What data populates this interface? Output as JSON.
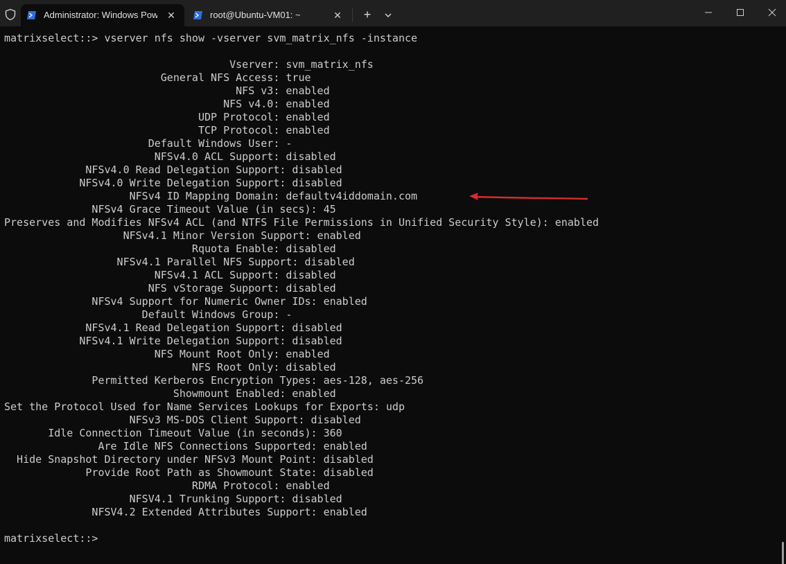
{
  "tabs": [
    {
      "label": "Administrator: Windows Powe",
      "active": true,
      "icon": "powershell-icon"
    },
    {
      "label": "root@Ubuntu-VM01: ~",
      "active": false,
      "icon": "powershell-icon"
    }
  ],
  "titlebar": {
    "new_tab": "+",
    "close_glyph": "✕"
  },
  "terminal": {
    "command_line": "matrixselect::> vserver nfs show -vserver svm_matrix_nfs -instance",
    "output_lines": [
      "                                    Vserver: svm_matrix_nfs",
      "                         General NFS Access: true",
      "                                     NFS v3: enabled",
      "                                   NFS v4.0: enabled",
      "                               UDP Protocol: enabled",
      "                               TCP Protocol: enabled",
      "                       Default Windows User: -",
      "                        NFSv4.0 ACL Support: disabled",
      "             NFSv4.0 Read Delegation Support: disabled",
      "            NFSv4.0 Write Delegation Support: disabled",
      "                    NFSv4 ID Mapping Domain: defaultv4iddomain.com",
      "              NFSv4 Grace Timeout Value (in secs): 45",
      "Preserves and Modifies NFSv4 ACL (and NTFS File Permissions in Unified Security Style): enabled",
      "                   NFSv4.1 Minor Version Support: enabled",
      "                              Rquota Enable: disabled",
      "                  NFSv4.1 Parallel NFS Support: disabled",
      "                        NFSv4.1 ACL Support: disabled",
      "                       NFS vStorage Support: disabled",
      "              NFSv4 Support for Numeric Owner IDs: enabled",
      "                      Default Windows Group: -",
      "             NFSv4.1 Read Delegation Support: disabled",
      "            NFSv4.1 Write Delegation Support: disabled",
      "                        NFS Mount Root Only: enabled",
      "                              NFS Root Only: disabled",
      "              Permitted Kerberos Encryption Types: aes-128, aes-256",
      "                           Showmount Enabled: enabled",
      "Set the Protocol Used for Name Services Lookups for Exports: udp",
      "                    NFSv3 MS-DOS Client Support: disabled",
      "       Idle Connection Timeout Value (in seconds): 360",
      "               Are Idle NFS Connections Supported: enabled",
      "  Hide Snapshot Directory under NFSv3 Mount Point: disabled",
      "             Provide Root Path as Showmount State: disabled",
      "                              RDMA Protocol: enabled",
      "                    NFSV4.1 Trunking Support: disabled",
      "              NFSV4.2 Extended Attributes Support: enabled"
    ],
    "prompt": "matrixselect::>"
  },
  "colors": {
    "terminal_bg": "#0c0c0c",
    "titlebar_bg": "#202020",
    "text": "#cccccc",
    "annotation": "#d92b2b",
    "ps_icon": "#2f6fd8"
  }
}
